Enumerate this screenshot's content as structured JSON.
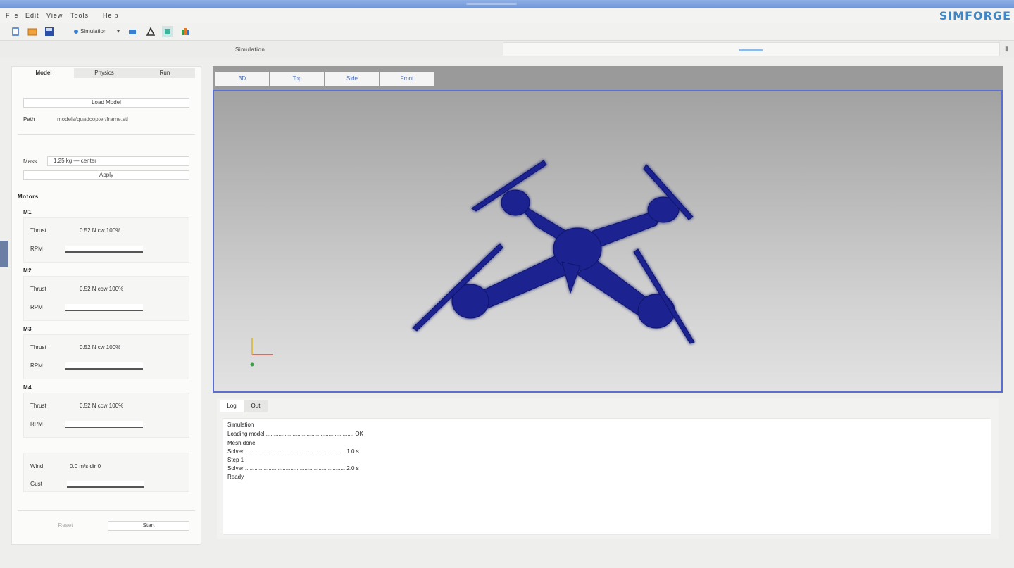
{
  "brand": "SIMFORGE",
  "menu": [
    "File",
    "Edit",
    "View",
    "Tools",
    "Help"
  ],
  "toolbar": {
    "mode_label": "Simulation",
    "buttons": [
      "new-icon",
      "open-icon",
      "save-icon",
      "settings-icon",
      "arrow-icon",
      "text-icon",
      "select-icon",
      "chart-icon"
    ]
  },
  "header": {
    "center_label": "Simulation"
  },
  "side_panel": {
    "tabs": [
      "Model",
      "Physics",
      "Run"
    ],
    "load_button": "Load Model",
    "path_label": "Path",
    "path_value": "models/quadcopter/frame.stl",
    "mass_label": "Mass",
    "mass_value": "1.25 kg — center",
    "apply_button": "Apply",
    "motors_label": "Motors",
    "motors": [
      {
        "name": "M1",
        "thrust_label": "Thrust",
        "thrust_value": "0.52 N  cw  100%",
        "rpm_label": "RPM"
      },
      {
        "name": "M2",
        "thrust_label": "Thrust",
        "thrust_value": "0.52 N  ccw  100%",
        "rpm_label": "RPM"
      },
      {
        "name": "M3",
        "thrust_label": "Thrust",
        "thrust_value": "0.52 N  cw  100%",
        "rpm_label": "RPM"
      },
      {
        "name": "M4",
        "thrust_label": "Thrust",
        "thrust_value": "0.52 N  ccw  100%",
        "rpm_label": "RPM"
      }
    ],
    "env_label": "Wind",
    "env_value": "0.0 m/s  dir 0",
    "env_row2_label": "Gust",
    "reset_button": "Reset",
    "start_button": "Start"
  },
  "viewport": {
    "tabs": [
      "3D",
      "Top",
      "Side",
      "Front"
    ],
    "model_color": "#1c2290",
    "frame_color": "#5a6fd6"
  },
  "console": {
    "tabs": [
      "Log",
      "Out"
    ],
    "lines": [
      "Simulation",
      "Loading model ........................................................ OK",
      "Mesh  done",
      "Solver  ................................................................ 1.0 s",
      "Step  1",
      "Solver  ................................................................ 2.0 s",
      "Ready"
    ]
  }
}
